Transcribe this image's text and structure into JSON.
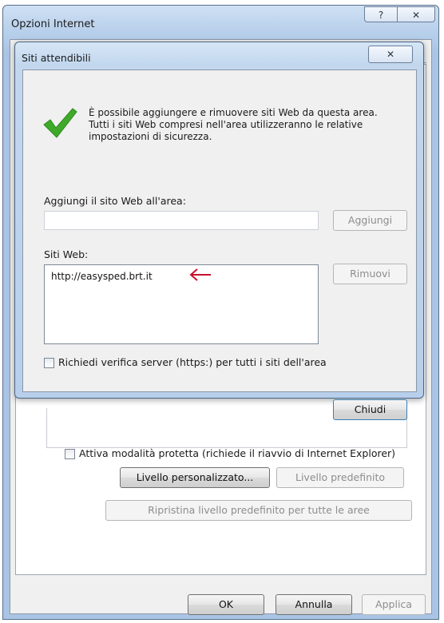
{
  "outer_window": {
    "title": "Opzioni Internet",
    "help_button": "?",
    "close_button": "✕",
    "protected_mode_label": "Attiva modalità protetta (richiede il riavvio di Internet Explorer)",
    "custom_level_button": "Livello personalizzato...",
    "default_level_button": "Livello predefinito",
    "reset_all_button": "Ripristina livello predefinito per tutte le aree",
    "ok_button": "OK",
    "cancel_button": "Annulla",
    "apply_button": "Applica"
  },
  "trusted_sites_dialog": {
    "title": "Siti attendibili",
    "close_button": "✕",
    "info_line1": "È possibile aggiungere e rimuovere siti Web da questa area.",
    "info_line2": "Tutti i siti Web compresi nell'area utilizzeranno le relative",
    "info_line3": "impostazioni di sicurezza.",
    "add_site_label": "Aggiungi il sito Web all'area:",
    "add_site_value": "",
    "add_button": "Aggiungi",
    "websites_label": "Siti Web:",
    "websites": [
      "http://easysped.brt.it"
    ],
    "remove_button": "Rimuovi",
    "https_label": "Richiedi verifica server (https:) per tutti i siti dell'area",
    "close_dialog_button": "Chiudi"
  },
  "colors": {
    "annotation_arrow": "#c8102e",
    "checkmark": "#3faa2a"
  },
  "icons": {
    "checkmark": "checkmark-icon",
    "arrow": "arrow-left-icon"
  }
}
